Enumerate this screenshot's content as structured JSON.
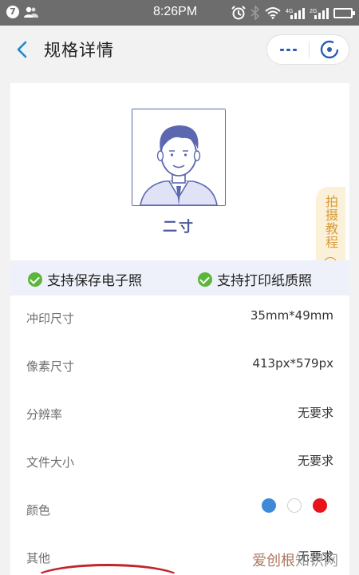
{
  "status_bar": {
    "badge": "7",
    "time": "8:26PM"
  },
  "nav": {
    "title": "规格详情"
  },
  "photo": {
    "label": "二寸"
  },
  "tutorial": {
    "label": "拍摄教程"
  },
  "support": [
    {
      "label": "支持保存电子照"
    },
    {
      "label": "支持打印纸质照"
    }
  ],
  "specs": [
    {
      "key": "冲印尺寸",
      "value": "35mm*49mm"
    },
    {
      "key": "像素尺寸",
      "value": "413px*579px"
    },
    {
      "key": "分辨率",
      "value": "无要求"
    },
    {
      "key": "文件大小",
      "value": "无要求"
    },
    {
      "key": "颜色",
      "colors": [
        "#3f8ad8",
        "#ffffff",
        "#e8141b"
      ]
    },
    {
      "key": "其他",
      "value": "无要求"
    }
  ],
  "watermark": {
    "brand": "爱创根",
    "suffix": "知识网"
  },
  "accent": "#1f88c9"
}
